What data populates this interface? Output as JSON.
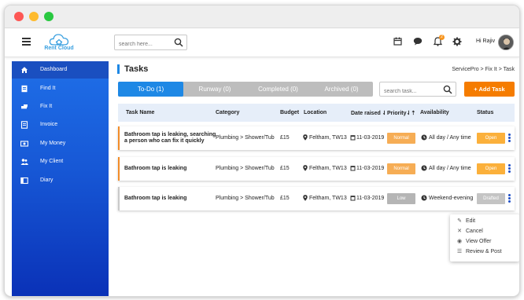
{
  "header": {
    "logo_text": "Rent Cloud",
    "search_placeholder": "search here...",
    "notification_count": "2",
    "greeting": "Hi Rajiv"
  },
  "sidebar": {
    "items": [
      {
        "label": "Dashboard",
        "icon": "home-icon",
        "active": true
      },
      {
        "label": "Find It",
        "icon": "document-icon"
      },
      {
        "label": "Fix It",
        "icon": "hand-icon"
      },
      {
        "label": "Invoice",
        "icon": "invoice-icon"
      },
      {
        "label": "My Money",
        "icon": "money-icon"
      },
      {
        "label": "My Client",
        "icon": "users-icon"
      },
      {
        "label": "Diary",
        "icon": "book-icon"
      }
    ]
  },
  "page": {
    "title": "Tasks",
    "breadcrumb": "ServicePro > Fix It > Task"
  },
  "tabs": [
    {
      "label": "To-Do (1)",
      "active": true
    },
    {
      "label": "Runway (0)"
    },
    {
      "label": "Completed (0)"
    },
    {
      "label": "Archived (0)"
    }
  ],
  "task_search_placeholder": "search task...",
  "add_task_label": "+ Add Task",
  "table": {
    "headers": [
      "Task Name",
      "Category",
      "Budget",
      "Location",
      "Date raised ⇃",
      "Priority⇃⇡",
      "Availability",
      "Status"
    ],
    "rows": [
      {
        "name_line1": "Bathroom tap is leaking, searching",
        "name_line2": "a person who can fix it quickly",
        "category": "Plumbing > Shower/Tub",
        "budget": "£15",
        "location": "Feltham, TW13",
        "date": "11-03-2019",
        "priority": "Normal",
        "availability": "All day / Any time",
        "status": "Open"
      },
      {
        "name_line1": "Bathroom tap is leaking",
        "name_line2": "",
        "category": "Plumbing > Shower/Tub",
        "budget": "£15",
        "location": "Feltham, TW13",
        "date": "11-03-2019",
        "priority": "Normal",
        "availability": "All day / Any time",
        "status": "Open"
      },
      {
        "name_line1": "Bathroom tap is leaking",
        "name_line2": "",
        "category": "Plumbing > Shower/Tub",
        "budget": "£15",
        "location": "Feltham, TW13",
        "date": "11-03-2019",
        "priority": "Low",
        "availability": "Weekend-evening",
        "status": "Drafted"
      }
    ]
  },
  "context_menu": {
    "items": [
      {
        "label": "Edit",
        "icon": "pencil-icon"
      },
      {
        "label": "Cancel",
        "icon": "close-icon"
      },
      {
        "label": "View Offer",
        "icon": "eye-icon"
      },
      {
        "label": "Review & Post",
        "icon": "list-icon"
      }
    ]
  },
  "colors": {
    "accent": "#1e88e5",
    "sidebar_top": "#1f6fe8",
    "sidebar_bottom": "#0a31b7",
    "add_button": "#f57c00",
    "normal_priority": "#f6ad55",
    "open_status": "#fbb03b",
    "low_priority": "#b5b5b5",
    "kebab": "#1e4fc8"
  }
}
